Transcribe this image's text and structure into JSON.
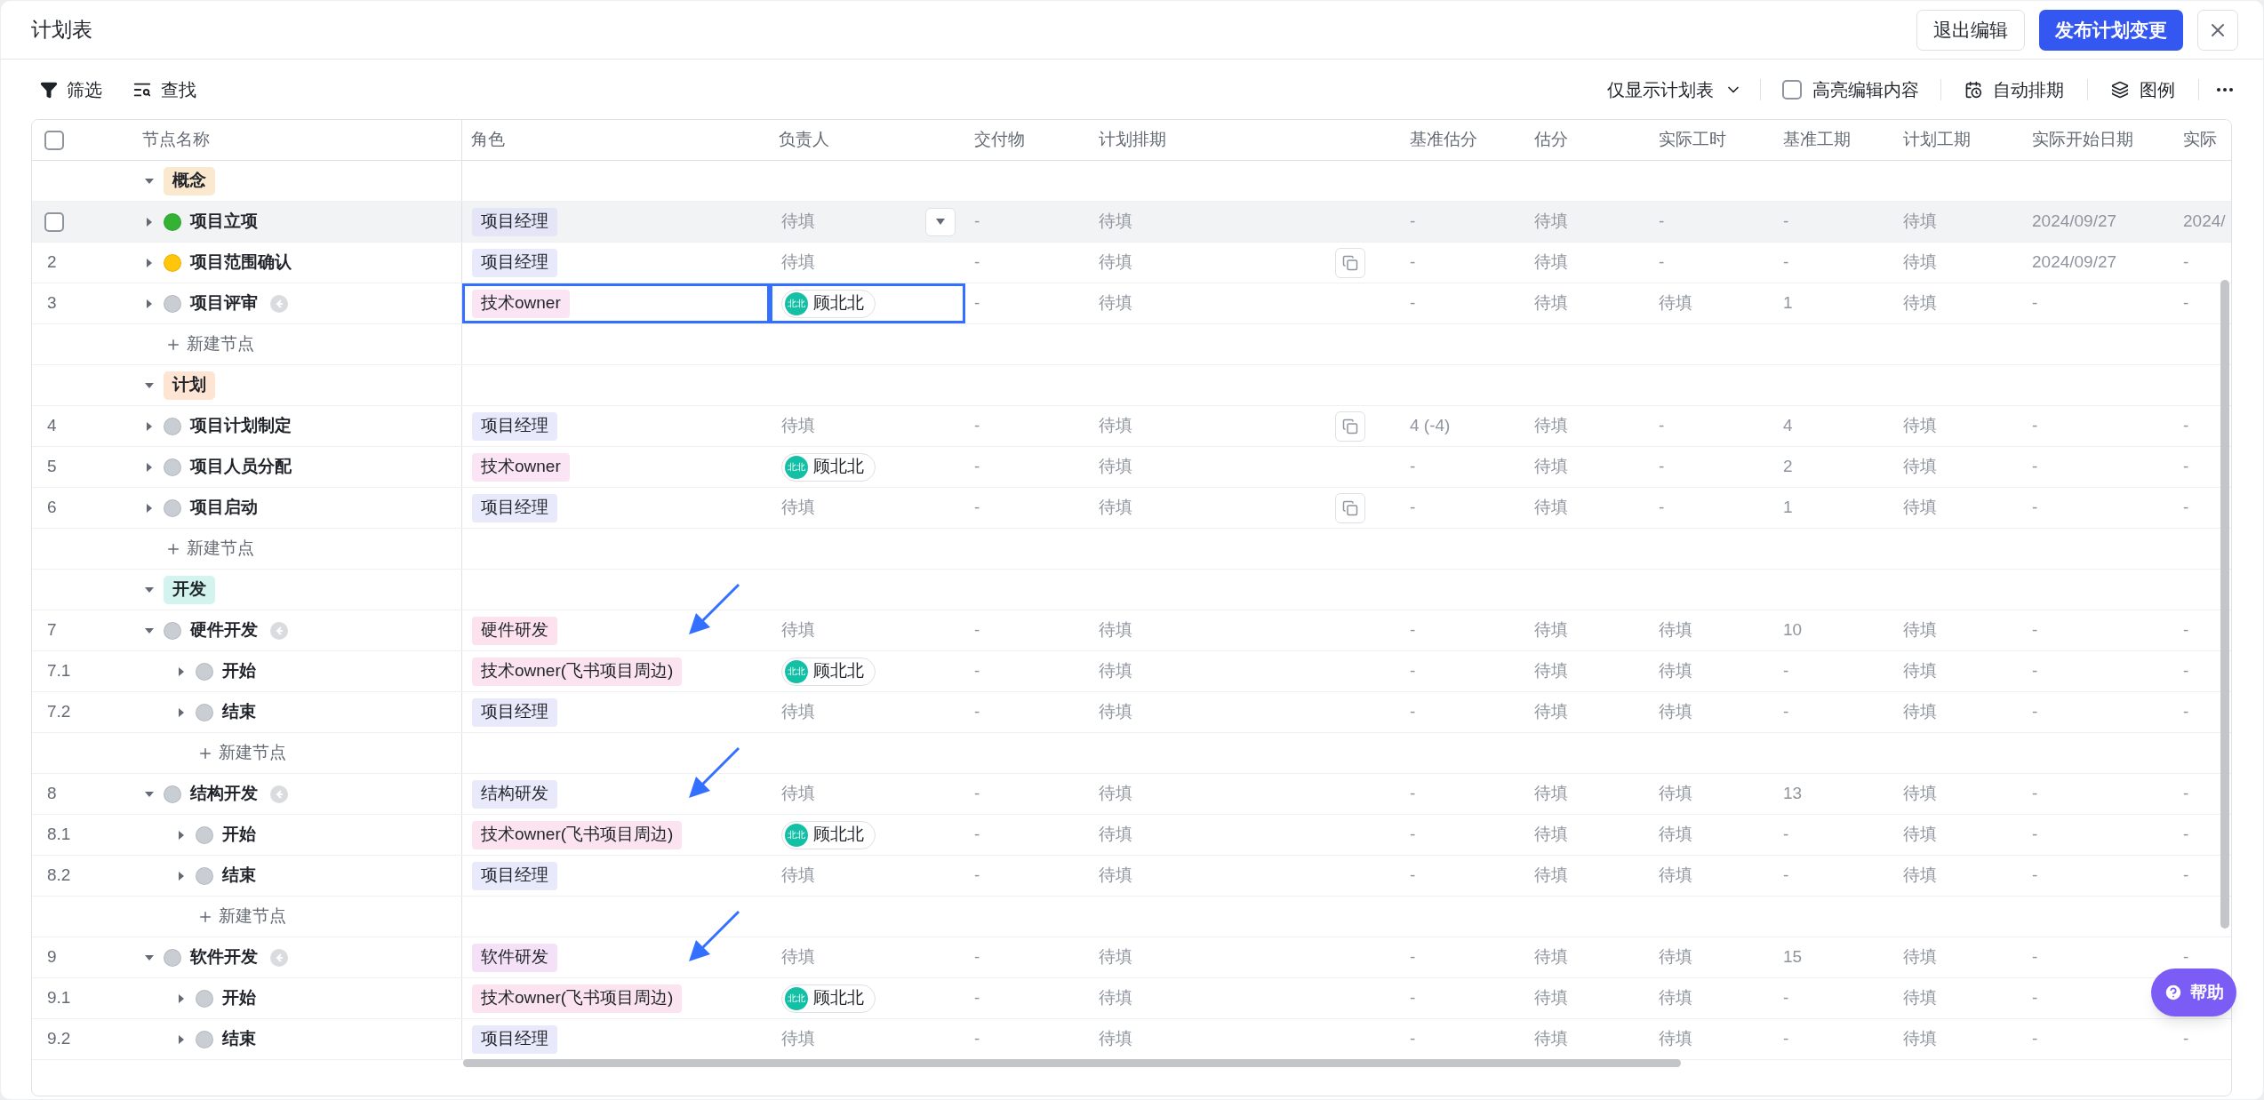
{
  "dialog": {
    "title": "计划表",
    "buttons": [
      {
        "label": "退出编辑",
        "kind": "secondary"
      },
      {
        "label": "发布计划变更",
        "kind": "primary"
      }
    ]
  },
  "toolbar": {
    "filter": "筛选",
    "find": "查找",
    "view_select": "仅显示计划表",
    "highlight": {
      "label": "高亮编辑内容",
      "checked": false
    },
    "auto_schedule": "自动排期",
    "legend": "图例"
  },
  "table": {
    "header_checkbox": {
      "checked": false
    },
    "columns": [
      "节点名称",
      "角色",
      "负责人",
      "交付物",
      "计划排期",
      "基准估分",
      "估分",
      "实际工时",
      "基准工期",
      "计划工期",
      "实际开始日期",
      "实际"
    ],
    "rows": [
      {
        "kind": "phase",
        "label": "概念",
        "color": "#fbe9cf",
        "expanded": true,
        "children": [
          {
            "kind": "task",
            "name": "项目立项",
            "color": "#34b233",
            "hovered": true,
            "selected": false,
            "expanded": false,
            "badge": false,
            "annotated": false,
            "copy": false,
            "role": {
              "label": "项目经理",
              "color": "#e4e5f7"
            },
            "owner": {
              "kind": "empty",
              "text": "待填"
            },
            "deliverable": "-",
            "schedule": "待填",
            "values": [
              "-",
              "待填",
              "-",
              "-",
              "待填",
              "2024/09/27",
              "2024/"
            ]
          },
          {
            "kind": "task",
            "number": "2",
            "name": "项目范围确认",
            "color": "#ffc60a",
            "hovered": false,
            "selected": false,
            "expanded": false,
            "badge": false,
            "annotated": false,
            "copy": true,
            "role": {
              "label": "项目经理",
              "color": "#e8e9fb"
            },
            "owner": {
              "kind": "empty",
              "text": "待填"
            },
            "deliverable": "-",
            "schedule": "待填",
            "values": [
              "-",
              "待填",
              "-",
              "-",
              "待填",
              "2024/09/27",
              "-"
            ]
          },
          {
            "kind": "task",
            "number": "3",
            "name": "项目评审",
            "color": "#c9cdd4",
            "hovered": false,
            "selected": true,
            "expanded": false,
            "badge": true,
            "annotated": false,
            "copy": false,
            "role": {
              "label": "技术owner",
              "color": "#fbe4f4"
            },
            "owner": {
              "kind": "person",
              "name": "顾北北",
              "initials": "北北"
            },
            "deliverable": "-",
            "schedule": "待填",
            "values": [
              "-",
              "待填",
              "待填",
              "1",
              "待填",
              "-",
              "-"
            ]
          },
          {
            "kind": "add",
            "label": "新建节点"
          }
        ]
      },
      {
        "kind": "phase",
        "label": "计划",
        "color": "#fee5d3",
        "expanded": true,
        "children": [
          {
            "kind": "task",
            "number": "4",
            "name": "项目计划制定",
            "color": "#c9cdd4",
            "hovered": false,
            "selected": false,
            "expanded": false,
            "badge": false,
            "annotated": false,
            "copy": true,
            "role": {
              "label": "项目经理",
              "color": "#e8e9fb"
            },
            "owner": {
              "kind": "empty",
              "text": "待填"
            },
            "deliverable": "-",
            "schedule": "待填",
            "values": [
              "4 (-4)",
              "待填",
              "-",
              "4",
              "待填",
              "-",
              "-"
            ]
          },
          {
            "kind": "task",
            "number": "5",
            "name": "项目人员分配",
            "color": "#c9cdd4",
            "hovered": false,
            "selected": false,
            "expanded": false,
            "badge": false,
            "annotated": false,
            "copy": false,
            "role": {
              "label": "技术owner",
              "color": "#fbe4f4"
            },
            "owner": {
              "kind": "person",
              "name": "顾北北",
              "initials": "北北"
            },
            "deliverable": "-",
            "schedule": "待填",
            "values": [
              "-",
              "待填",
              "-",
              "2",
              "待填",
              "-",
              "-"
            ]
          },
          {
            "kind": "task",
            "number": "6",
            "name": "项目启动",
            "color": "#c9cdd4",
            "hovered": false,
            "selected": false,
            "expanded": false,
            "badge": false,
            "annotated": false,
            "copy": true,
            "role": {
              "label": "项目经理",
              "color": "#e8e9fb"
            },
            "owner": {
              "kind": "empty",
              "text": "待填"
            },
            "deliverable": "-",
            "schedule": "待填",
            "values": [
              "-",
              "待填",
              "-",
              "1",
              "待填",
              "-",
              "-"
            ]
          },
          {
            "kind": "add",
            "label": "新建节点"
          }
        ]
      },
      {
        "kind": "phase",
        "label": "开发",
        "color": "#d3f3ee",
        "expanded": true,
        "children": [
          {
            "kind": "task",
            "number": "7",
            "name": "硬件开发",
            "color": "#c9cdd4",
            "hovered": false,
            "selected": false,
            "expanded": true,
            "badge": true,
            "annotated": true,
            "copy": false,
            "role": {
              "label": "硬件研发",
              "color": "#fde2ee"
            },
            "owner": {
              "kind": "empty",
              "text": "待填"
            },
            "deliverable": "-",
            "schedule": "待填",
            "values": [
              "-",
              "待填",
              "待填",
              "10",
              "待填",
              "-",
              "-"
            ],
            "children": [
              {
                "kind": "task",
                "number": "7.1",
                "name": "开始",
                "color": "#c9cdd4",
                "hovered": false,
                "selected": false,
                "expanded": false,
                "badge": false,
                "annotated": false,
                "copy": false,
                "role": {
                  "label": "技术owner(飞书项目周边)",
                  "color": "#fbe4f0"
                },
                "owner": {
                  "kind": "person",
                  "name": "顾北北",
                  "initials": "北北"
                },
                "deliverable": "-",
                "schedule": "待填",
                "values": [
                  "-",
                  "待填",
                  "待填",
                  "-",
                  "待填",
                  "-",
                  "-"
                ]
              },
              {
                "kind": "task",
                "number": "7.2",
                "name": "结束",
                "color": "#c9cdd4",
                "hovered": false,
                "selected": false,
                "expanded": false,
                "badge": false,
                "annotated": false,
                "copy": false,
                "role": {
                  "label": "项目经理",
                  "color": "#e8e9fb"
                },
                "owner": {
                  "kind": "empty",
                  "text": "待填"
                },
                "deliverable": "-",
                "schedule": "待填",
                "values": [
                  "-",
                  "待填",
                  "待填",
                  "-",
                  "待填",
                  "-",
                  "-"
                ]
              },
              {
                "kind": "add",
                "label": "新建节点"
              }
            ]
          },
          {
            "kind": "task",
            "number": "8",
            "name": "结构开发",
            "color": "#c9cdd4",
            "hovered": false,
            "selected": false,
            "expanded": true,
            "badge": true,
            "annotated": true,
            "copy": false,
            "role": {
              "label": "结构研发",
              "color": "#e8e9fb"
            },
            "owner": {
              "kind": "empty",
              "text": "待填"
            },
            "deliverable": "-",
            "schedule": "待填",
            "values": [
              "-",
              "待填",
              "待填",
              "13",
              "待填",
              "-",
              "-"
            ],
            "children": [
              {
                "kind": "task",
                "number": "8.1",
                "name": "开始",
                "color": "#c9cdd4",
                "hovered": false,
                "selected": false,
                "expanded": false,
                "badge": false,
                "annotated": false,
                "copy": false,
                "role": {
                  "label": "技术owner(飞书项目周边)",
                  "color": "#fbe4f0"
                },
                "owner": {
                  "kind": "person",
                  "name": "顾北北",
                  "initials": "北北"
                },
                "deliverable": "-",
                "schedule": "待填",
                "values": [
                  "-",
                  "待填",
                  "待填",
                  "-",
                  "待填",
                  "-",
                  "-"
                ]
              },
              {
                "kind": "task",
                "number": "8.2",
                "name": "结束",
                "color": "#c9cdd4",
                "hovered": false,
                "selected": false,
                "expanded": false,
                "badge": false,
                "annotated": false,
                "copy": false,
                "role": {
                  "label": "项目经理",
                  "color": "#e8e9fb"
                },
                "owner": {
                  "kind": "empty",
                  "text": "待填"
                },
                "deliverable": "-",
                "schedule": "待填",
                "values": [
                  "-",
                  "待填",
                  "待填",
                  "-",
                  "待填",
                  "-",
                  "-"
                ]
              },
              {
                "kind": "add",
                "label": "新建节点"
              }
            ]
          },
          {
            "kind": "task",
            "number": "9",
            "name": "软件开发",
            "color": "#c9cdd4",
            "hovered": false,
            "selected": false,
            "expanded": true,
            "badge": true,
            "annotated": true,
            "copy": false,
            "role": {
              "label": "软件研发",
              "color": "#f5e1f7"
            },
            "owner": {
              "kind": "empty",
              "text": "待填"
            },
            "deliverable": "-",
            "schedule": "待填",
            "values": [
              "-",
              "待填",
              "待填",
              "15",
              "待填",
              "-",
              "-"
            ],
            "children": [
              {
                "kind": "task",
                "number": "9.1",
                "name": "开始",
                "color": "#c9cdd4",
                "hovered": false,
                "selected": false,
                "expanded": false,
                "badge": false,
                "annotated": false,
                "copy": false,
                "role": {
                  "label": "技术owner(飞书项目周边)",
                  "color": "#fbe4f0"
                },
                "owner": {
                  "kind": "person",
                  "name": "顾北北",
                  "initials": "北北"
                },
                "deliverable": "-",
                "schedule": "待填",
                "values": [
                  "-",
                  "待填",
                  "待填",
                  "-",
                  "待填",
                  "-"
                ]
              },
              {
                "kind": "task",
                "number": "9.2",
                "name": "结束",
                "color": "#c9cdd4",
                "hovered": false,
                "selected": false,
                "expanded": false,
                "badge": false,
                "annotated": false,
                "copy": false,
                "role": {
                  "label": "项目经理",
                  "color": "#e8e9fb"
                },
                "owner": {
                  "kind": "empty",
                  "text": "待填"
                },
                "deliverable": "-",
                "schedule": "待填",
                "values": [
                  "-",
                  "待填",
                  "待填",
                  "-",
                  "待填",
                  "-",
                  "-"
                ]
              }
            ]
          }
        ]
      }
    ]
  },
  "help": {
    "label": "帮助"
  }
}
